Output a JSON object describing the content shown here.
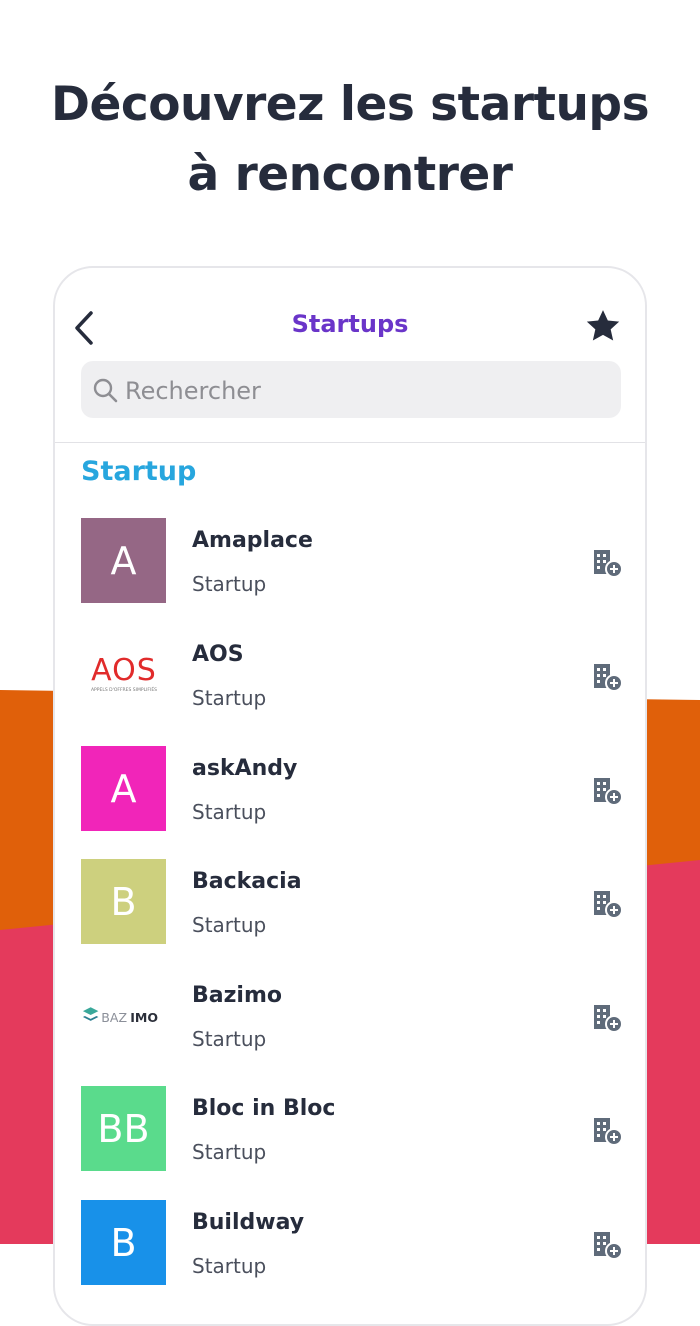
{
  "headline": {
    "line1": "Découvrez les startups",
    "line2": "à rencontrer"
  },
  "navbar": {
    "title": "Startups",
    "back_icon": "chevron-left-icon",
    "favorite_icon": "star-icon"
  },
  "search": {
    "placeholder": "Rechercher",
    "value": ""
  },
  "section": {
    "title": "Startup"
  },
  "colors": {
    "accent_purple": "#6a35c9",
    "section_blue": "#27a6de",
    "bg_orange": "#e0600a",
    "bg_pink": "#e43a5c"
  },
  "startups": [
    {
      "name": "Amaplace",
      "type": "Startup",
      "initials": "A",
      "color": "#956785"
    },
    {
      "name": "AOS",
      "type": "Startup",
      "logo_text": "AOS",
      "logo_tagline": "APPELS D'OFFRES SIMPLIFIÉS"
    },
    {
      "name": "askAndy",
      "type": "Startup",
      "initials": "A",
      "color": "#f125b9"
    },
    {
      "name": "Backacia",
      "type": "Startup",
      "initials": "B",
      "color": "#cdd07e"
    },
    {
      "name": "Bazimo",
      "type": "Startup",
      "logo_text_light": "BAZ",
      "logo_text_bold": "IMO"
    },
    {
      "name": "Bloc in Bloc",
      "type": "Startup",
      "initials": "BB",
      "color": "#5adb8c"
    },
    {
      "name": "Buildway",
      "type": "Startup",
      "initials": "B",
      "color": "#1891e9"
    }
  ],
  "row_action_icon": "building-add-icon"
}
